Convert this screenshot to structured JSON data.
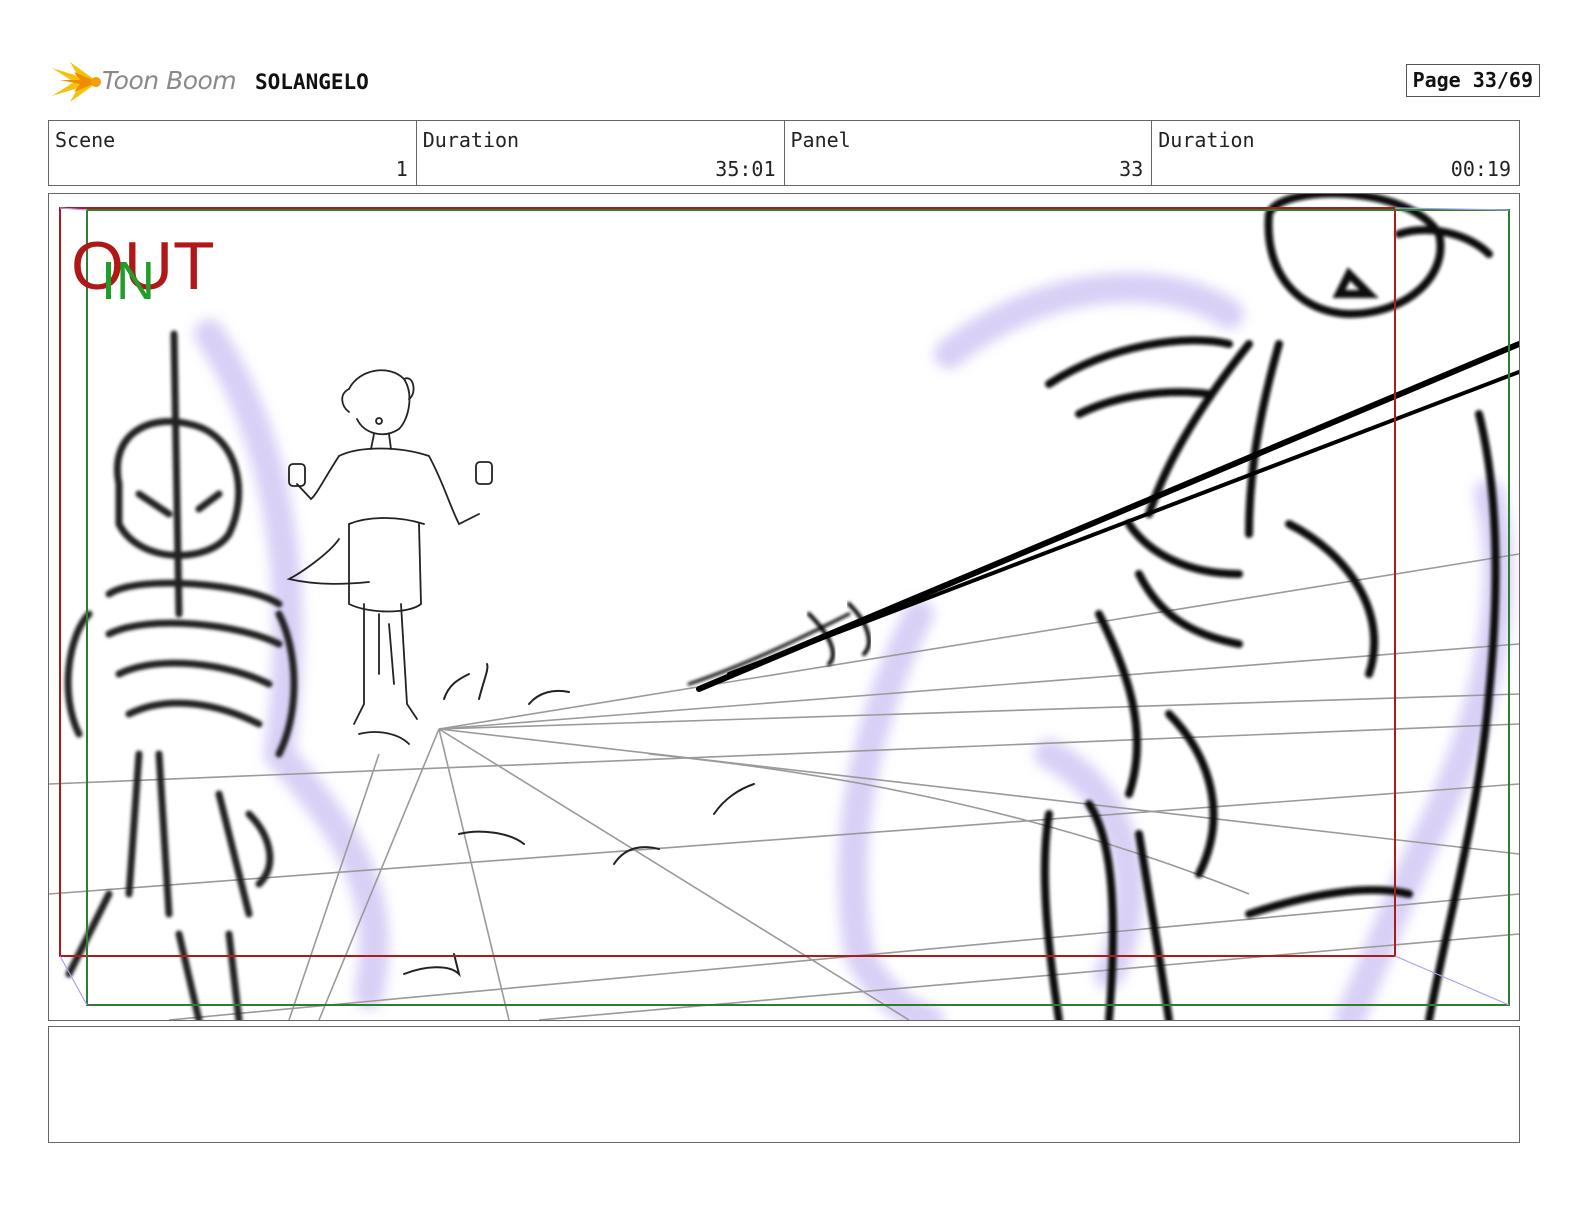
{
  "header": {
    "logo_text": "Toon Boom",
    "project_title": "SOLANGELO",
    "page_label": "Page",
    "page_number": "33/69"
  },
  "info": {
    "scene_label": "Scene",
    "scene_value": "1",
    "scene_duration_label": "Duration",
    "scene_duration_value": "35:01",
    "panel_label": "Panel",
    "panel_value": "33",
    "panel_duration_label": "Duration",
    "panel_duration_value": "00:19"
  },
  "panel": {
    "out_marker": "OUT",
    "in_marker": "IN",
    "out_color": "#b01818",
    "in_color": "#1f9e2a",
    "frame_out_color": "#a81c1c",
    "frame_in_color": "#2e7d32",
    "glow_color": "#cfc4f2"
  },
  "notes": {
    "text": ""
  }
}
